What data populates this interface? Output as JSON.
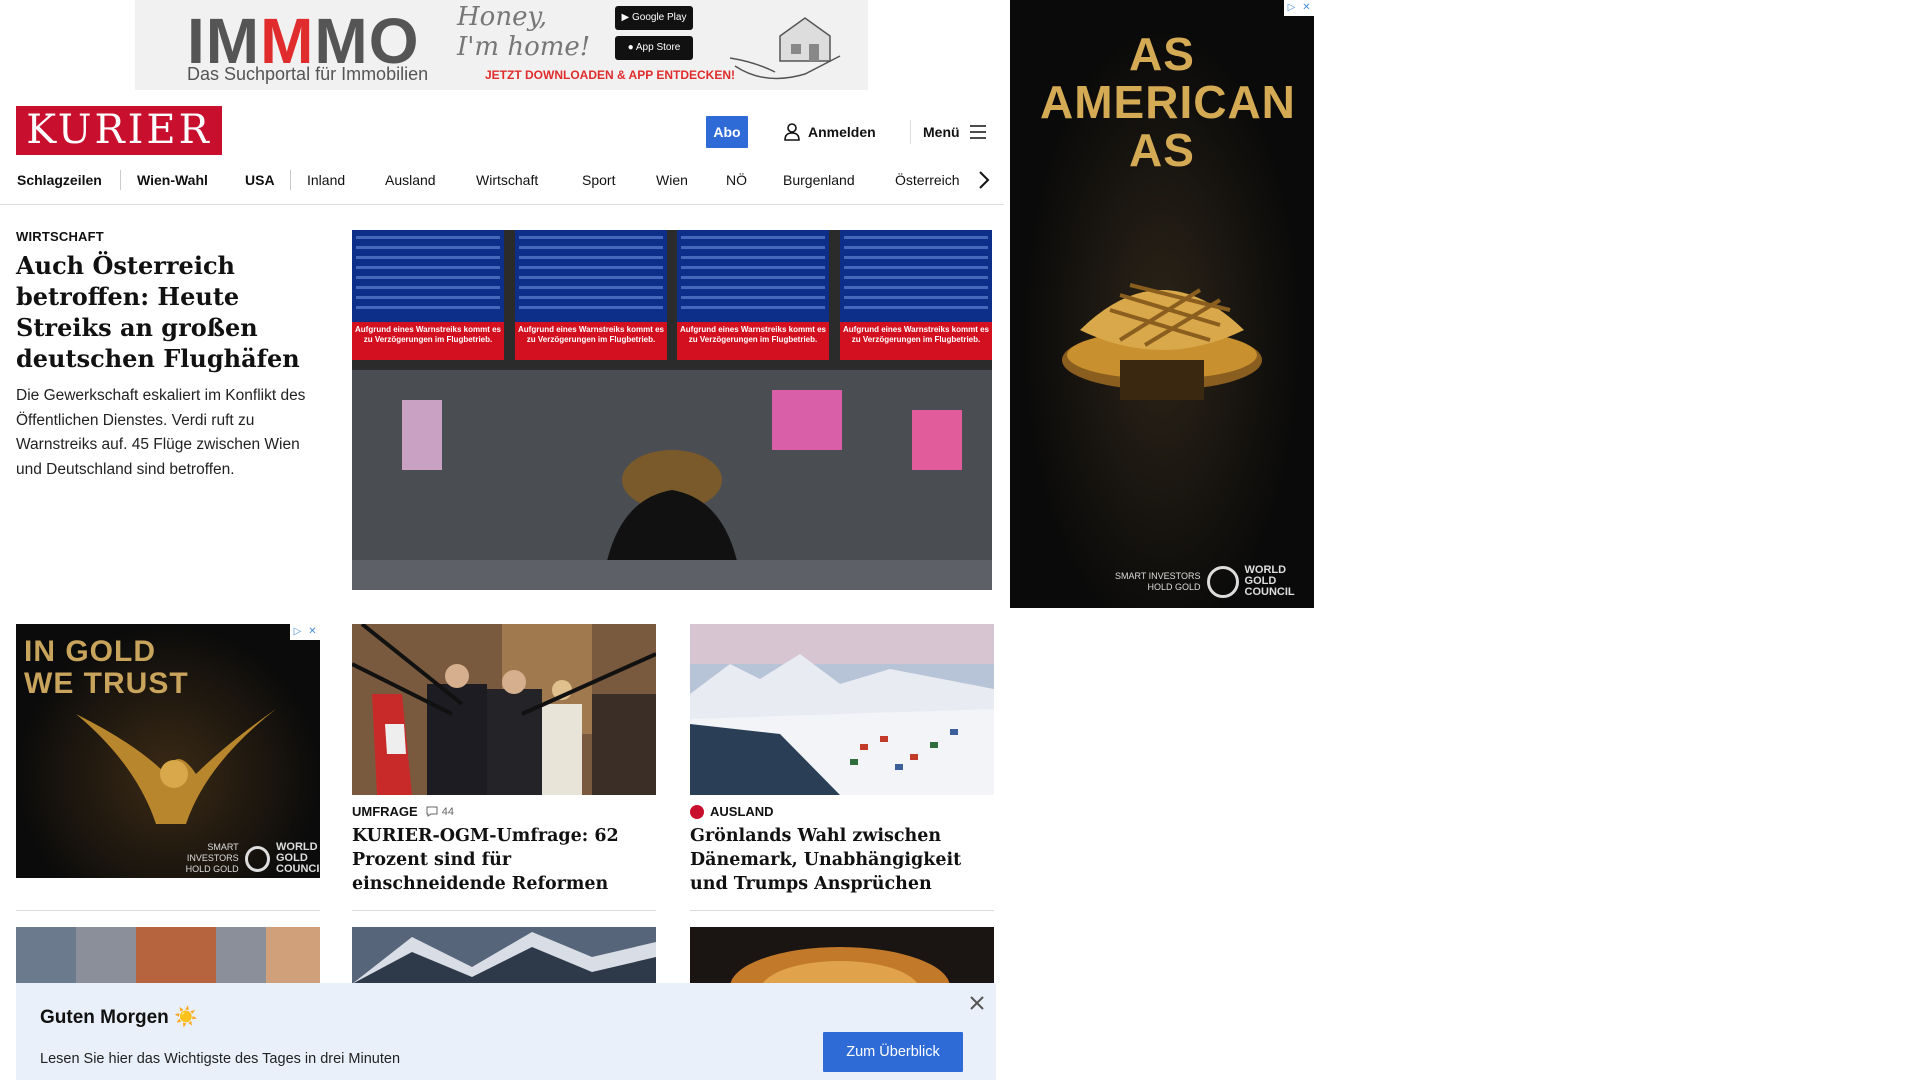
{
  "ads": {
    "top": {
      "brand_prefix": "IM",
      "brand_mid": "M",
      "brand_suffix": "MO",
      "tagline": "Das Suchportal für Immobilien",
      "script": "Honey, I'm home!",
      "google_play": "Google Play",
      "app_store": "App Store",
      "cta": "JETZT DOWNLOADEN & APP ENTDECKEN!"
    },
    "right": {
      "headline": "AS AMERICAN AS",
      "sponsor_line1": "SMART INVESTORS",
      "sponsor_line2": "HOLD GOLD",
      "council": "WORLD GOLD COUNCIL"
    },
    "gold": {
      "headline": "IN GOLD WE TRUST",
      "sponsor_line1": "SMART INVESTORS",
      "sponsor_line2": "HOLD GOLD",
      "council": "WORLD GOLD COUNCIL"
    }
  },
  "header": {
    "logo": "KURIER",
    "abo": "Abo",
    "login": "Anmelden",
    "menu": "Menü"
  },
  "nav": [
    "Schlagzeilen",
    "Wien-Wahl",
    "USA",
    "Inland",
    "Ausland",
    "Wirtschaft",
    "Sport",
    "Wien",
    "NÖ",
    "Burgenland",
    "Österreich"
  ],
  "lead": {
    "kicker": "WIRTSCHAFT",
    "title": "Auch Österreich betroffen: Heute Streiks an großen deutschen Flughäfen",
    "text": "Die Gewerkschaft eskaliert im Konflikt des Öffentlichen Dienstes. Verdi ruft zu Warnstreiks auf. 45 Flüge zwischen Wien und Deutschland sind betroffen.",
    "board_notice": "Aufgrund eines Warnstreiks kommt es zu Verzögerungen im Flugbetrieb."
  },
  "cards": [
    {
      "kicker": "UMFRAGE",
      "comments": "44",
      "title": "KURIER-OGM-Umfrage: 62 Prozent sind für einschneidende Reformen"
    },
    {
      "kicker": "AUSLAND",
      "title": "Grönlands Wahl zwischen Dänemark, Unabhängigkeit und Trumps Ansprüchen"
    }
  ],
  "toast": {
    "title": "Guten Morgen ☀️",
    "text": "Lesen Sie hier das Wichtigste des Tages in drei Minuten",
    "button": "Zum Überblick"
  },
  "colors": {
    "brand_red": "#c8102e",
    "accent_blue": "#2e6bd6",
    "toast_bg": "#eaf0fa"
  }
}
